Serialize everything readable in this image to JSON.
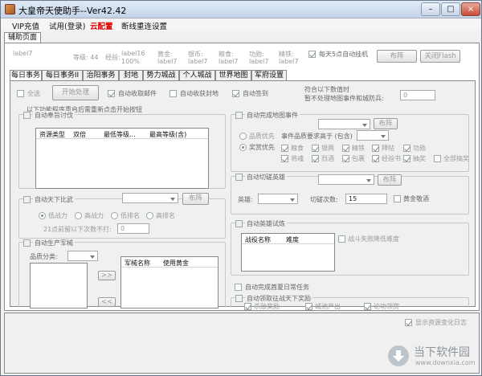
{
  "window": {
    "title": "大皇帝天使助手--Ver42.42",
    "min": "–",
    "max": "□",
    "close": "×"
  },
  "menu": [
    "VIP充值",
    "试用(登录)",
    "云配置",
    "断线重连设置"
  ],
  "outer_tab": "辅助页面",
  "stats": {
    "label17_a": "label7",
    "level": "等级: 44",
    "exp": "经验:",
    "exp_val": "label16",
    "exp_pct": "100%",
    "gold": "黄金:",
    "gold_val": "label7",
    "silver": "银币:",
    "silver_val": "label7",
    "food": "粮食:",
    "food_val": "label7",
    "merit": "功勋:",
    "merit_val": "label7",
    "iron": "精铁:",
    "iron_val": "label7",
    "auto_daily5": "每天5点自动挂机",
    "deploy": "布阵",
    "close_flash": "关闭Flash"
  },
  "tabs": [
    "每日事务",
    "每日事务II",
    "治阳事务",
    "封地",
    "势力城战",
    "个人城战",
    "世界地图",
    "军府设置"
  ],
  "daily": {
    "select_all": "全选",
    "start": "开始处理",
    "auto_mail": "自动收取邮件",
    "auto_fief": "自动收获封地",
    "auto_signin": "自动签到",
    "exclude_l1": "符合以下数值时",
    "exclude_l2": "暂不处理地图事件和城防兵:",
    "exclude_val": "0",
    "restart_note": "以下功能程序重启后需重新点击开始按钮",
    "auto_recruit": "自动奉旨讨伐",
    "recruit_cols": [
      "资源类型",
      "双倍",
      "最低等级...",
      "最高等级(含)"
    ],
    "auto_tianxia": "自动天下比武",
    "deploy": "布阵",
    "radio_labels": [
      "低战力",
      "高战力",
      "低排名",
      "高排名"
    ],
    "skip_l1": "21点前留以下次数不打:",
    "skip_val": "0",
    "auto_produce": "自动生产军械",
    "quality": "品质分类:",
    "prod_cols": [
      "军械名称",
      "使用黄金"
    ],
    "arrow_right": ">>",
    "arrow_left": "<<"
  },
  "right": {
    "map_event": "自动完成地图事件",
    "deploy": "布阵",
    "quality_first": "品质优先",
    "event_req": "事件品质要求高于 (包含)",
    "reward_first": "奖赏优先",
    "rewards": [
      "粮食",
      "银两",
      "精铁",
      "拜帖",
      "功勋",
      "将魂",
      "烈酒",
      "包裹",
      "经验书",
      "抽奖"
    ],
    "select_all": "全部搞奖",
    "auto_cut": "自动切磋英雄",
    "hero": "英雄:",
    "cut_times": "切磋次数:",
    "cut_val": "15",
    "gold_wine": "黄金敬酒",
    "auto_trial": "自动英雄试炼",
    "trial_cols": [
      "战役名称",
      "难度"
    ],
    "fail_lower": "战斗失败降低难度",
    "auto_daily": "自动完成酋夏日常任务",
    "auto_tianxia": "自动领取征战天下奖励",
    "kill_reward": "杀敌奖励",
    "city_output": "城池产出",
    "merit_ring": "论功领赏"
  },
  "footer": {
    "show_changes": "显示资源变化日志"
  },
  "watermark": {
    "text": "当下软件园",
    "url": "www.downxia.com"
  }
}
